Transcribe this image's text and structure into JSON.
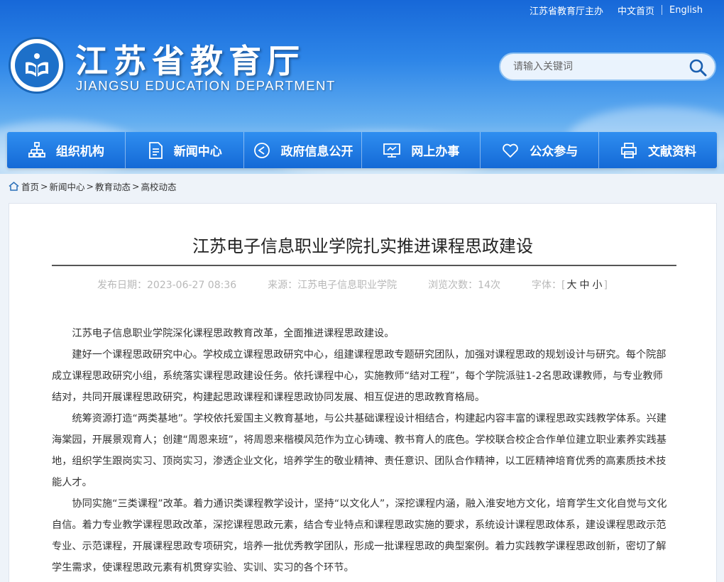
{
  "topbar": {
    "host": "江苏省教育厅主办",
    "home": "中文首页",
    "english": "English"
  },
  "header": {
    "title": "江苏省教育厅",
    "subtitle": "JIANGSU EDUCATION DEPARTMENT"
  },
  "search": {
    "placeholder": "请输入关键词"
  },
  "nav": [
    {
      "label": "组织机构",
      "icon": "org-chart-icon"
    },
    {
      "label": "新闻中心",
      "icon": "document-icon"
    },
    {
      "label": "政府信息公开",
      "icon": "play-circle-icon"
    },
    {
      "label": "网上办事",
      "icon": "monitor-icon"
    },
    {
      "label": "公众参与",
      "icon": "heart-icon"
    },
    {
      "label": "文献资料",
      "icon": "printer-icon"
    }
  ],
  "breadcrumb": [
    "首页",
    "新闻中心",
    "教育动态",
    "高校动态"
  ],
  "article": {
    "title": "江苏电子信息职业学院扎实推进课程思政建设",
    "date_label": "发布日期：2023-06-27 08:36",
    "source_label": "来源：江苏电子信息职业学院",
    "views_label": "浏览次数：14次",
    "font_label": "字体：",
    "font_large": "大",
    "font_medium": "中",
    "font_small": "小",
    "paragraphs": [
      "江苏电子信息职业学院深化课程思政教育改革，全面推进课程思政建设。",
      "建好一个课程思政研究中心。学校成立课程思政研究中心，组建课程思政专题研究团队，加强对课程思政的规划设计与研究。每个院部成立课程思政研究小组，系统落实课程思政建设任务。依托课程中心，实施教师“结对工程”，每个学院派驻1-2名思政课教师，与专业教师结对，共同开展课程思政研究，构建起思政课程和课程思政协同发展、相互促进的思政教育格局。",
      "统筹资源打造“两类基地”。学校依托爱国主义教育基地，与公共基础课程设计相结合，构建起内容丰富的课程思政实践教学体系。兴建海棠园，开展景观育人；创建“周恩来班”，将周恩来楷模风范作为立心铸魂、教书育人的底色。学校联合校企合作单位建立职业素养实践基地，组织学生跟岗实习、顶岗实习，渗透企业文化，培养学生的敬业精神、责任意识、团队合作精神，以工匠精神培育优秀的高素质技术技能人才。",
      "协同实施“三类课程”改革。着力通识类课程教学设计，坚持“以文化人”，深挖课程内涵，融入淮安地方文化，培育学生文化自觉与文化自信。着力专业教学课程思政改革，深挖课程思政元素，结合专业特点和课程思政实施的要求，系统设计课程思政体系，建设课程思政示范专业、示范课程，开展课程思政专项研究，培养一批优秀教学团队，形成一批课程思政的典型案例。着力实践教学课程思政创新，密切了解学生需求，使课程思政元素有机贯穿实验、实训、实习的各个环节。"
    ]
  }
}
